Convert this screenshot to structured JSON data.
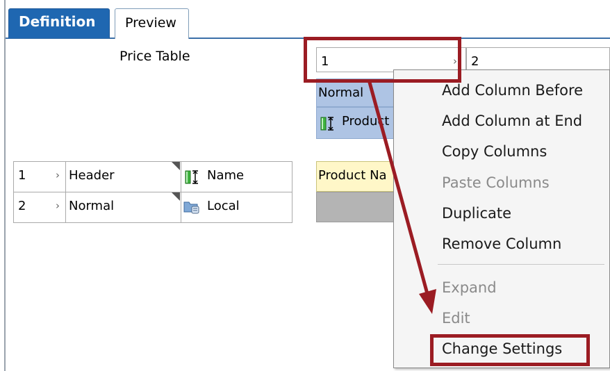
{
  "tabs": [
    {
      "label": "Definition",
      "active": true
    },
    {
      "label": "Preview",
      "active": false
    }
  ],
  "left_panel": {
    "title": "Price Table",
    "rows": [
      {
        "index": "1",
        "type": "Header",
        "icon": "column-size-icon",
        "value": "Name"
      },
      {
        "index": "2",
        "type": "Normal",
        "icon": "local-data-icon",
        "value": "Local"
      }
    ]
  },
  "right_grid": {
    "columns": [
      {
        "label": "1"
      },
      {
        "label": "2"
      }
    ],
    "normal_label": "Normal",
    "product_label": "Product",
    "product_name_label": "Product Na"
  },
  "context_menu": {
    "items": [
      {
        "label": "Add Column Before",
        "enabled": true
      },
      {
        "label": "Add Column at End",
        "enabled": true
      },
      {
        "label": "Copy Columns",
        "enabled": true
      },
      {
        "label": "Paste Columns",
        "enabled": false
      },
      {
        "label": "Duplicate",
        "enabled": true
      },
      {
        "label": "Remove Column",
        "enabled": true
      },
      {
        "label": "Expand",
        "enabled": false
      },
      {
        "label": "Edit",
        "enabled": false
      },
      {
        "label": "Change Settings",
        "enabled": true,
        "highlighted": true
      }
    ]
  },
  "colors": {
    "accent": "#1f67b1",
    "annotation": "#9b1c23",
    "row_selected": "#aec4e4",
    "row_header": "#fff7c8"
  }
}
